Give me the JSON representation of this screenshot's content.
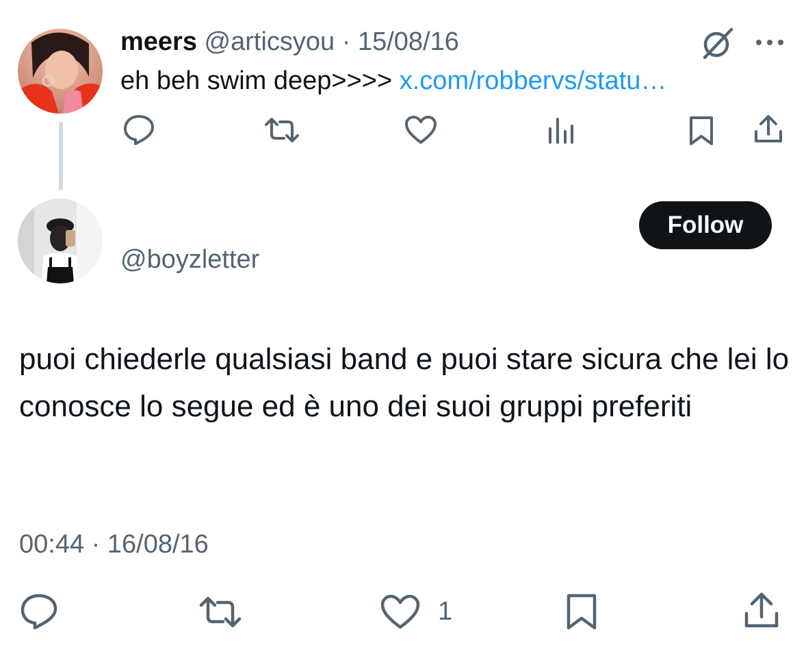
{
  "parent_tweet": {
    "author_name": "meers",
    "handle": "@articsyou",
    "separator": "·",
    "date": "15/08/16",
    "text": "eh beh swim deep>>>>",
    "link": "x.com/robbervs/statu…",
    "header_icons": [
      "grok-icon",
      "more-icon"
    ],
    "actions": [
      "reply-icon",
      "retweet-icon",
      "like-icon",
      "views-icon",
      "bookmark-icon",
      "share-icon"
    ]
  },
  "reply_tweet": {
    "handle": "@boyzletter",
    "follow_label": "Follow",
    "text": "puoi chiederle qualsiasi band e puoi stare sicura che lei lo conosce lo segue ed è uno dei suoi gruppi preferiti",
    "time": "00:44",
    "separator": "·",
    "date": "16/08/16",
    "like_count": "1",
    "actions": [
      "reply-icon",
      "retweet-icon",
      "like-icon",
      "bookmark-icon",
      "share-icon"
    ]
  },
  "colors": {
    "text": "#0f1419",
    "secondary": "#536471",
    "link": "#1d9bf0",
    "thread_line": "#cfd9de",
    "follow_bg": "#0f1419"
  }
}
